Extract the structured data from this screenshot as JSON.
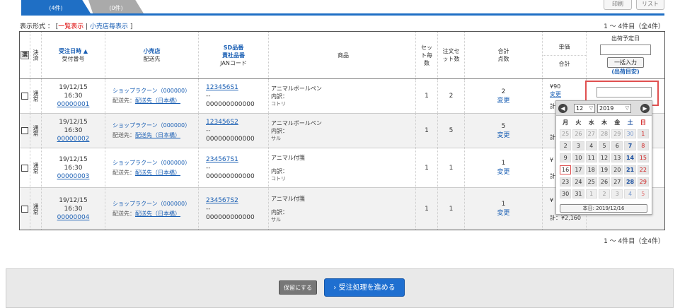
{
  "tabs": [
    {
      "label": "(4件)"
    },
    {
      "label": "(0件)"
    }
  ],
  "top_buttons": [
    "印刷",
    "リスト"
  ],
  "display_mode": {
    "prefix": "表示形式 ： [",
    "list_all": "一覧表示",
    "sep": " | ",
    "by_shop": "小売店毎表示",
    "suffix": " ]"
  },
  "count_text": "1 ～ 4件目（全4件）",
  "headers": {
    "all": "選",
    "settle": "決済",
    "order_date": "受注日時 ▲",
    "order_no": "受付番号",
    "shop": "小売店",
    "dest": "配送先",
    "sd1": "SD品番",
    "sd2": "責社品番",
    "jan": "JANコード",
    "item": "商品",
    "set_count": "セット毎数",
    "order_set": "注文セット数",
    "total_qty": "合計点数",
    "unit_price": "単価",
    "total": "合計",
    "ship_date": "出荷予定日",
    "bulk_btn": "一括入力",
    "ship_hint": "(出荷目安)"
  },
  "rows": [
    {
      "settle": "通常",
      "date": "19/12/15",
      "time": "16:30",
      "order_no": "00000001",
      "shop": "ショップラクーン（000000）",
      "dest_label": "配送先：",
      "dest": "配送先（日本橋）",
      "sd": "123456S1",
      "sd2": "--",
      "jan": "000000000000",
      "item": "アニマルボールペン",
      "detail": "内訳：",
      "detail2": "コトリ",
      "set_count": "1",
      "order_set": "2",
      "total_qty": "2",
      "change": "変更",
      "price": "¥90",
      "price_change": "変更",
      "total_price": "計："
    },
    {
      "settle": "通常",
      "date": "19/12/15",
      "time": "16:30",
      "order_no": "00000002",
      "shop": "ショップラクーン（000000）",
      "dest_label": "配送先：",
      "dest": "配送先（日本橋）",
      "sd": "123456S2",
      "sd2": "--",
      "jan": "000000000000",
      "item": "アニマルボールペン",
      "detail": "内訳：",
      "detail2": "サル",
      "set_count": "1",
      "order_set": "5",
      "total_qty": "5",
      "change": "変更",
      "price": "",
      "price_change": "",
      "total_price": "計："
    },
    {
      "settle": "通常",
      "date": "19/12/15",
      "time": "16:30",
      "order_no": "00000003",
      "shop": "ショップラクーン（000000）",
      "dest_label": "配送先：",
      "dest": "配送先（日本橋）",
      "sd": "234567S1",
      "sd2": "--",
      "jan": "000000000000",
      "item": "アニマル付箋",
      "detail": "内訳：",
      "detail2": "コトリ",
      "set_count": "1",
      "order_set": "1",
      "total_qty": "1",
      "change": "変更",
      "price": "¥",
      "price_change": "",
      "total_price": "計："
    },
    {
      "settle": "通常",
      "date": "19/12/15",
      "time": "16:30",
      "order_no": "00000004",
      "shop": "ショップラクーン（000000）",
      "dest_label": "配送先：",
      "dest": "配送先（日本橋）",
      "sd": "234567S2",
      "sd2": "--",
      "jan": "000000000000",
      "item": "アニマル付箋",
      "detail": "内訳：",
      "detail2": "サル",
      "set_count": "1",
      "order_set": "1",
      "total_qty": "1",
      "change": "変更",
      "price": "¥",
      "price_change": "",
      "total_price": "計：¥2,160"
    }
  ],
  "calendar": {
    "prev": "◀",
    "next": "▶",
    "month": "12",
    "year": "2019",
    "dow": [
      "月",
      "火",
      "水",
      "木",
      "金",
      "土",
      "日"
    ],
    "days": [
      [
        "25",
        "26",
        "27",
        "28",
        "29",
        "30",
        "1"
      ],
      [
        "2",
        "3",
        "4",
        "5",
        "6",
        "7",
        "8"
      ],
      [
        "9",
        "10",
        "11",
        "12",
        "13",
        "14",
        "15"
      ],
      [
        "16",
        "17",
        "18",
        "19",
        "20",
        "21",
        "22"
      ],
      [
        "23",
        "24",
        "25",
        "26",
        "27",
        "28",
        "29"
      ],
      [
        "30",
        "31",
        "1",
        "2",
        "3",
        "4",
        "5"
      ]
    ],
    "today_btn": "本日: 2019/12/16"
  },
  "footer": {
    "hold": "保留にする",
    "proceed": "› 受注処理を進める"
  },
  "colors": {
    "accent": "#1f6fc5",
    "highlight": "#e05050",
    "link": "#1a5fb4"
  }
}
